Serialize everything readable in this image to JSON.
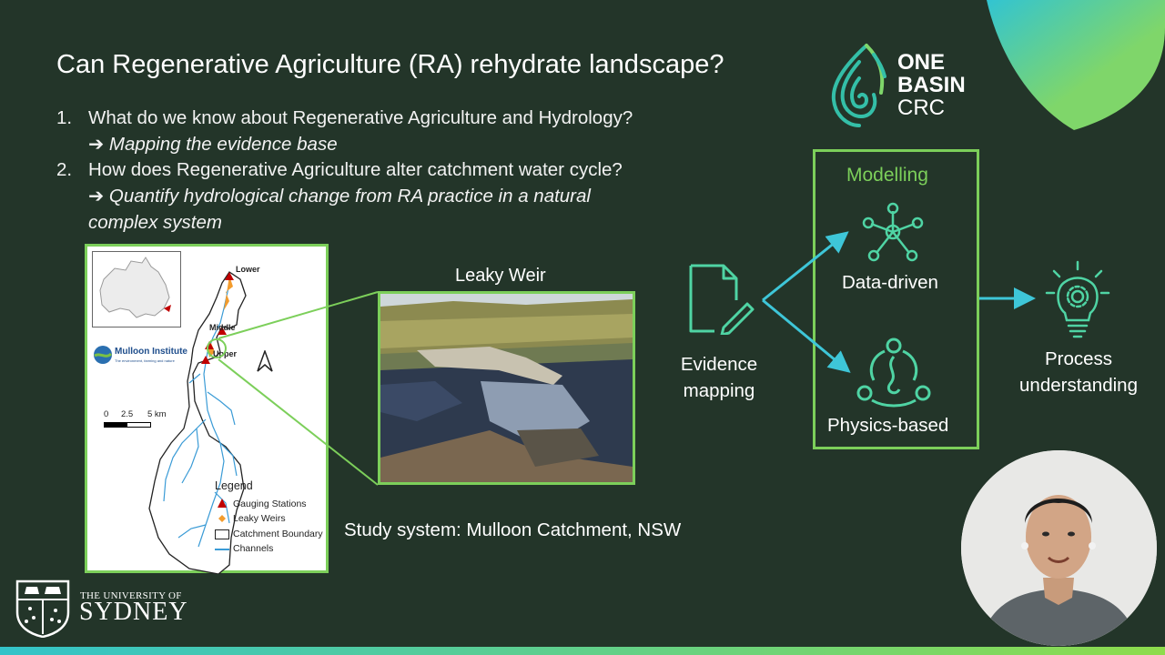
{
  "slide": {
    "title": "Can Regenerative Agriculture (RA) rehydrate landscape?",
    "questions": [
      {
        "num": "1.",
        "text": "What do we know about Regenerative Agriculture and Hydrology?",
        "sub": "➔ Mapping the evidence base"
      },
      {
        "num": "2.",
        "text": "How does Regenerative Agriculture alter catchment water cycle?",
        "sub_line1": "➔ Quantify hydrological change from RA practice in a natural",
        "sub_line2": "complex system"
      }
    ]
  },
  "logo": {
    "line1": "ONE",
    "line2": "BASIN",
    "line3": "CRC"
  },
  "map": {
    "labels": {
      "lower": "Lower",
      "middle": "Middle",
      "upper": "Upper"
    },
    "institute": "Mulloon Institute",
    "institute_tagline": "The environment, farming and nature",
    "scale": {
      "t0": "0",
      "t1": "2.5",
      "t2": "5 km"
    },
    "legend": {
      "title": "Legend",
      "items": [
        "Gauging Stations",
        "Leaky Weirs",
        "Catchment Boundary",
        "Channels"
      ]
    }
  },
  "photo": {
    "label": "Leaky Weir"
  },
  "study_caption": "Study system: Mulloon Catchment, NSW",
  "flow": {
    "modelling": "Modelling",
    "data_driven": "Data-driven",
    "physics_based": "Physics-based",
    "evidence_line1": "Evidence",
    "evidence_line2": "mapping",
    "process_line1": "Process",
    "process_line2": "understanding"
  },
  "university": {
    "small": "THE UNIVERSITY OF",
    "big": "SYDNEY"
  },
  "colors": {
    "background": "#233529",
    "accent_green": "#7ccf5a",
    "accent_teal": "#3ec6d8"
  }
}
